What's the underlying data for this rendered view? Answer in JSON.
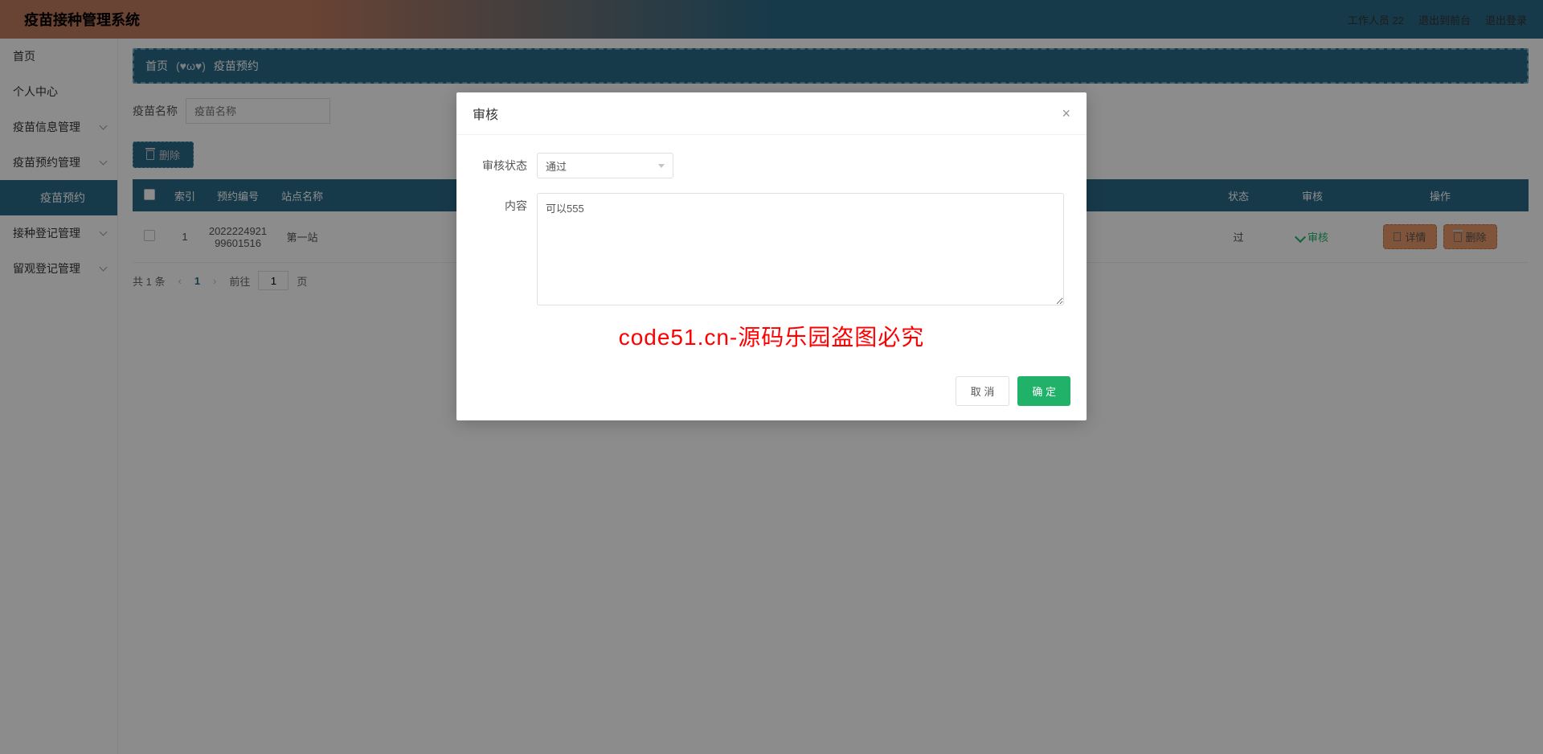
{
  "header": {
    "title": "疫苗接种管理系统",
    "user_label": "工作人员 22",
    "back_label": "退出到前台",
    "logout_label": "退出登录"
  },
  "sidebar": {
    "items": [
      {
        "label": "首页",
        "expandable": false
      },
      {
        "label": "个人中心",
        "expandable": false
      },
      {
        "label": "疫苗信息管理",
        "expandable": true
      },
      {
        "label": "疫苗预约管理",
        "expandable": true
      },
      {
        "label": "疫苗预约",
        "expandable": false,
        "sub": true,
        "active": true
      },
      {
        "label": "接种登记管理",
        "expandable": true
      },
      {
        "label": "留观登记管理",
        "expandable": true
      }
    ]
  },
  "breadcrumb": {
    "home": "首页",
    "emoji": "(♥ω♥)",
    "current": "疫苗预约"
  },
  "search": {
    "label": "疫苗名称",
    "placeholder": "疫苗名称"
  },
  "delete_btn": "删除",
  "table": {
    "headers": {
      "index": "索引",
      "order_no": "预约编号",
      "station": "站点名称",
      "status": "状态",
      "audit": "审核",
      "ops": "操作"
    },
    "rows": [
      {
        "index": "1",
        "order_no": "2022224921996015​16",
        "station": "第一站",
        "status": "过",
        "audit_label": "审核",
        "detail": "详情",
        "delete": "删除"
      }
    ]
  },
  "pager": {
    "total": "共 1 条",
    "page": "1",
    "goto_label": "前往",
    "goto_value": "1",
    "page_suffix": "页"
  },
  "modal": {
    "title": "审核",
    "status_label": "审核状态",
    "status_value": "通过",
    "content_label": "内容",
    "content_value": "可以555",
    "watermark": "code51.cn-源码乐园盗图必究",
    "cancel": "取 消",
    "ok": "确 定"
  },
  "watermark_text": "code51.cn"
}
